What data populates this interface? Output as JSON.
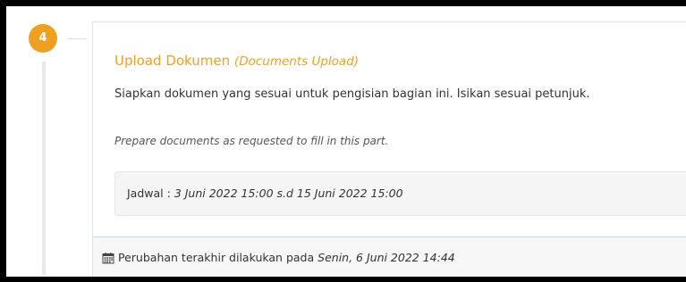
{
  "step": {
    "number": "4"
  },
  "card": {
    "title": "Upload Dokumen",
    "title_en": "(Documents Upload)",
    "description": "Siapkan dokumen yang sesuai untuk pengisian bagian ini. Isikan sesuai petunjuk.",
    "description_en": "Prepare documents as requested to fill in this part.",
    "schedule_label": "Jadwal :",
    "schedule_value": "3 Juni 2022 15:00 s.d 15 Juni 2022 15:00",
    "footer_label": "Perubahan terakhir dilakukan pada",
    "footer_date": "Senin, 6 Juni 2022 14:44",
    "footer_icon": "calendar-icon"
  },
  "colors": {
    "accent": "#f0a020",
    "footer_border": "#b9dcec"
  }
}
